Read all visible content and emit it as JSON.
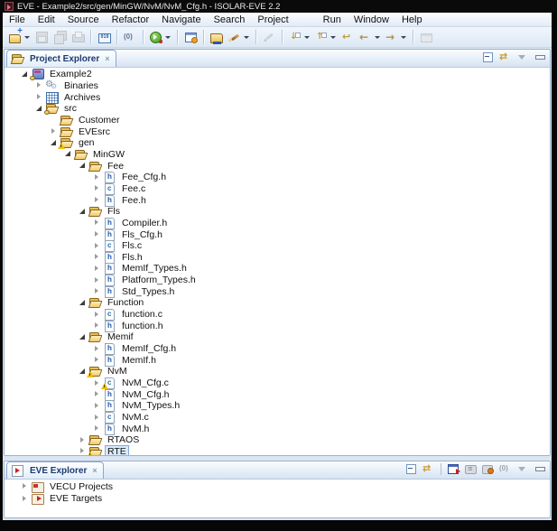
{
  "window": {
    "title": "EVE - Example2/src/gen/MinGW/NvM/NvM_Cfg.h - ISOLAR-EVE 2.2"
  },
  "menubar": {
    "items": [
      {
        "label": "File"
      },
      {
        "label": "Edit"
      },
      {
        "label": "Source"
      },
      {
        "label": "Refactor"
      },
      {
        "label": "Navigate"
      },
      {
        "label": "Search"
      },
      {
        "label": "Project"
      },
      {
        "label": "Run",
        "gap_before": true
      },
      {
        "label": "Window"
      },
      {
        "label": "Help"
      }
    ]
  },
  "toolbar": {
    "groups": [
      {
        "items": [
          {
            "name": "new",
            "dropdown": true
          },
          {
            "name": "save",
            "disabled": true
          },
          {
            "name": "save-all",
            "disabled": true
          },
          {
            "name": "print",
            "disabled": true
          }
        ]
      },
      {
        "items": [
          {
            "name": "binary-010"
          }
        ]
      },
      {
        "items": [
          {
            "name": "binary-paren"
          }
        ]
      },
      {
        "items": [
          {
            "name": "run",
            "dropdown": true
          }
        ]
      },
      {
        "items": [
          {
            "name": "trace-window"
          }
        ]
      },
      {
        "items": [
          {
            "name": "open-folder"
          },
          {
            "name": "brush",
            "dropdown": true
          }
        ]
      },
      {
        "items": [
          {
            "name": "pencil",
            "disabled": true
          }
        ]
      },
      {
        "items": [
          {
            "name": "next-annotation",
            "dropdown": true
          },
          {
            "name": "prev-annotation",
            "dropdown": true
          },
          {
            "name": "last-edit"
          },
          {
            "name": "back",
            "dropdown": true
          },
          {
            "name": "forward",
            "dropdown": true
          }
        ]
      },
      {
        "items": [
          {
            "name": "restore",
            "disabled": true
          }
        ]
      }
    ]
  },
  "project_view": {
    "tab_label": "Project Explorer",
    "close_glyph": "×",
    "buttons": [
      {
        "name": "collapse-all"
      },
      {
        "name": "link-with-editor"
      },
      {
        "name": "view-menu"
      },
      {
        "name": "minimize"
      }
    ],
    "tree": [
      {
        "label": "Example2",
        "level": 0,
        "expander": "expanded",
        "icon": "project",
        "overlay": "gold"
      },
      {
        "label": "Binaries",
        "level": 1,
        "expander": "collapsed",
        "icon": "binaries",
        "overlay": null
      },
      {
        "label": "Archives",
        "level": 1,
        "expander": "collapsed",
        "icon": "archives",
        "overlay": null
      },
      {
        "label": "src",
        "level": 1,
        "expander": "expanded",
        "icon": "folder",
        "overlay": "gold"
      },
      {
        "label": "Customer",
        "level": 2,
        "expander": "none",
        "icon": "folder",
        "overlay": null
      },
      {
        "label": "EVEsrc",
        "level": 2,
        "expander": "collapsed",
        "icon": "folder",
        "overlay": null
      },
      {
        "label": "gen",
        "level": 2,
        "expander": "expanded",
        "icon": "folder",
        "overlay": "warning"
      },
      {
        "label": "MinGW",
        "level": 3,
        "expander": "expanded",
        "icon": "folder",
        "overlay": null
      },
      {
        "label": "Fee",
        "level": 4,
        "expander": "expanded",
        "icon": "folder",
        "overlay": null
      },
      {
        "label": "Fee_Cfg.h",
        "level": 5,
        "expander": "collapsed",
        "icon": "file-h",
        "overlay": null
      },
      {
        "label": "Fee.c",
        "level": 5,
        "expander": "collapsed",
        "icon": "file-c",
        "overlay": null
      },
      {
        "label": "Fee.h",
        "level": 5,
        "expander": "collapsed",
        "icon": "file-h",
        "overlay": null
      },
      {
        "label": "Fls",
        "level": 4,
        "expander": "expanded",
        "icon": "folder",
        "overlay": null
      },
      {
        "label": "Compiler.h",
        "level": 5,
        "expander": "collapsed",
        "icon": "file-h",
        "overlay": null
      },
      {
        "label": "Fls_Cfg.h",
        "level": 5,
        "expander": "collapsed",
        "icon": "file-h",
        "overlay": null
      },
      {
        "label": "Fls.c",
        "level": 5,
        "expander": "collapsed",
        "icon": "file-c",
        "overlay": null
      },
      {
        "label": "Fls.h",
        "level": 5,
        "expander": "collapsed",
        "icon": "file-h",
        "overlay": null
      },
      {
        "label": "MemIf_Types.h",
        "level": 5,
        "expander": "collapsed",
        "icon": "file-h",
        "overlay": null
      },
      {
        "label": "Platform_Types.h",
        "level": 5,
        "expander": "collapsed",
        "icon": "file-h",
        "overlay": null
      },
      {
        "label": "Std_Types.h",
        "level": 5,
        "expander": "collapsed",
        "icon": "file-h",
        "overlay": null
      },
      {
        "label": "Function",
        "level": 4,
        "expander": "expanded",
        "icon": "folder",
        "overlay": null
      },
      {
        "label": "function.c",
        "level": 5,
        "expander": "collapsed",
        "icon": "file-c",
        "overlay": null
      },
      {
        "label": "function.h",
        "level": 5,
        "expander": "collapsed",
        "icon": "file-h",
        "overlay": null
      },
      {
        "label": "Memif",
        "level": 4,
        "expander": "expanded",
        "icon": "folder",
        "overlay": null
      },
      {
        "label": "MemIf_Cfg.h",
        "level": 5,
        "expander": "collapsed",
        "icon": "file-h",
        "overlay": null
      },
      {
        "label": "MemIf.h",
        "level": 5,
        "expander": "collapsed",
        "icon": "file-h",
        "overlay": null
      },
      {
        "label": "NvM",
        "level": 4,
        "expander": "expanded",
        "icon": "folder",
        "overlay": "warning"
      },
      {
        "label": "NvM_Cfg.c",
        "level": 5,
        "expander": "collapsed",
        "icon": "file-c",
        "overlay": "warning"
      },
      {
        "label": "NvM_Cfg.h",
        "level": 5,
        "expander": "collapsed",
        "icon": "file-h",
        "overlay": null
      },
      {
        "label": "NvM_Types.h",
        "level": 5,
        "expander": "collapsed",
        "icon": "file-h",
        "overlay": null
      },
      {
        "label": "NvM.c",
        "level": 5,
        "expander": "collapsed",
        "icon": "file-c",
        "overlay": null
      },
      {
        "label": "NvM.h",
        "level": 5,
        "expander": "collapsed",
        "icon": "file-h",
        "overlay": null
      },
      {
        "label": "RTAOS",
        "level": 4,
        "expander": "collapsed",
        "icon": "folder",
        "overlay": null
      },
      {
        "label": "RTE",
        "level": 4,
        "expander": "collapsed",
        "icon": "folder",
        "overlay": "warning",
        "selected": true
      }
    ]
  },
  "eve_view": {
    "tab_label": "EVE Explorer",
    "close_glyph": "×",
    "buttons": [
      {
        "name": "collapse-all"
      },
      {
        "name": "link-with-editor"
      },
      {
        "name": "separator"
      },
      {
        "name": "vecu-board"
      },
      {
        "name": "eve-gray"
      },
      {
        "name": "eve-orange"
      },
      {
        "name": "eve-counter"
      },
      {
        "name": "view-menu"
      },
      {
        "name": "minimize"
      }
    ],
    "tree": [
      {
        "label": "VECU Projects",
        "level": 0,
        "expander": "collapsed",
        "icon": "vecu",
        "overlay": null
      },
      {
        "label": "EVE Targets",
        "level": 0,
        "expander": "collapsed",
        "icon": "target",
        "overlay": null
      }
    ]
  },
  "colors": {
    "selection_bg": "#d9eafb",
    "selection_border": "#84a9d6",
    "folder": "#eec45e",
    "warning": "#edbe0e",
    "tab_text": "#1c3a70",
    "titlebar_bg": "#0a0a0a"
  }
}
